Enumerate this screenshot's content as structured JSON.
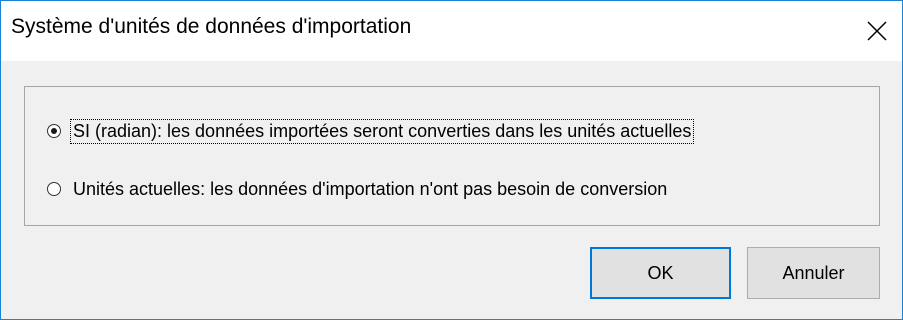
{
  "window": {
    "title": "Système d'unités de données d'importation",
    "close_icon": "close-icon"
  },
  "options": [
    {
      "label": "SI (radian): les données importées seront converties dans les unités actuelles",
      "selected": true
    },
    {
      "label": "Unités actuelles: les données d'importation n'ont pas besoin de conversion",
      "selected": false
    }
  ],
  "buttons": {
    "ok_label": "OK",
    "cancel_label": "Annuler"
  },
  "colors": {
    "accent": "#0078d7",
    "dialog_background": "#f0f0f0",
    "titlebar_background": "#ffffff"
  }
}
